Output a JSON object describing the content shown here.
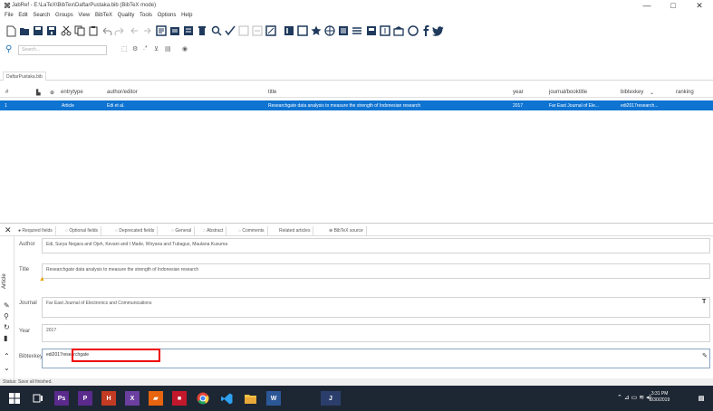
{
  "window": {
    "title": "JabRef - E:\\LaTeX\\BibTex\\DaftarPustaka.bib (BibTeX mode)",
    "minimize": "—",
    "maximize": "□",
    "close": "✕"
  },
  "menu": [
    "File",
    "Edit",
    "Search",
    "Groups",
    "View",
    "BibTeX",
    "Quality",
    "Tools",
    "Options",
    "Help"
  ],
  "search": {
    "placeholder": "Search..."
  },
  "database_tab": "DaftarPustaka.bib",
  "table": {
    "headers": {
      "hash": "#",
      "entrytype": "entrytype",
      "author_editor": "author/editor",
      "title": "title",
      "year": "year",
      "journal": "journal/booktitle",
      "bibtexkey": "bibtexkey",
      "bibtexkey_sort": "⌄",
      "ranking": "ranking"
    },
    "rows": [
      {
        "num": "1",
        "entrytype": "Article",
        "author": "Edi et al.",
        "title": "Researchgate data analysis to measure the strength of Indonesian research",
        "year": "2017",
        "journal": "Far East Journal of Ele...",
        "bibtexkey": "edi2017research..."
      }
    ]
  },
  "entry_editor": {
    "tabs": [
      "Required fields",
      "Optional fields",
      "Deprecated fields",
      "General",
      "Abstract",
      "Comments",
      "Related articles",
      "BibTeX source"
    ],
    "side_label": "Article",
    "fields": {
      "author_label": "Author",
      "author_value": "Edi, Surya Negara and Ojeh, Kevani and I Made, Wiryana and Tubagus, Maulana Kusuma",
      "title_label": "Title",
      "title_value": "Researchgate data analysis to measure the strength of Indonesian research",
      "journal_label": "Journal",
      "journal_value": "Far East Journal of Electronics and Communications",
      "year_label": "Year",
      "year_value": "2017",
      "bibtexkey_label": "Bibtexkey",
      "bibtexkey_value": "edi2017researchgate"
    }
  },
  "status": "Status: Save all finished.",
  "taskbar": {
    "time": "3:31 PM",
    "date": "6/30/2019"
  },
  "colors": {
    "selection": "#0e73d1",
    "highlight_box": "#e00000",
    "taskbar": "#1d2633"
  }
}
